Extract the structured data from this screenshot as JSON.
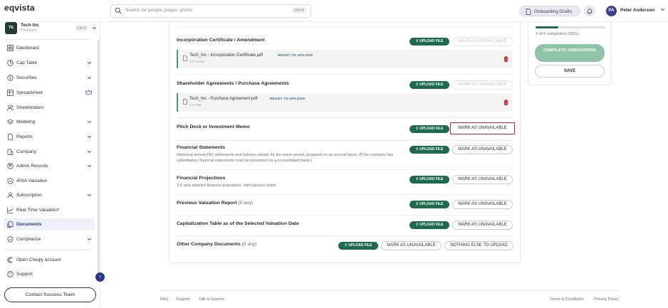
{
  "app": {
    "logo": "eqvista"
  },
  "search": {
    "placeholder": "Search for people, pages, grants",
    "shortcut": "Ctrl K"
  },
  "header": {
    "drafts_label": "Onboarding Drafts",
    "user_initials": "PA",
    "user_name": "Peter Anderson"
  },
  "company": {
    "initials": "TE",
    "name": "Tech Inc",
    "plan": "Premium",
    "shortcut": "Ctrl O"
  },
  "sidebar": {
    "items": [
      {
        "label": "Dashboard"
      },
      {
        "label": "Cap Table"
      },
      {
        "label": "Securities"
      },
      {
        "label": "Spreadsheet"
      },
      {
        "label": "Shareholders"
      },
      {
        "label": "Modeling"
      },
      {
        "label": "Reports"
      },
      {
        "label": "Company"
      },
      {
        "label": "Admin Records"
      },
      {
        "label": "409A Valuation"
      },
      {
        "label": "Subscription"
      },
      {
        "label": "Real-Time Valuation*"
      },
      {
        "label": "Documents"
      },
      {
        "label": "Compliance"
      }
    ],
    "bottom": [
      {
        "label": "Open Cheqly account"
      },
      {
        "label": "Support"
      }
    ],
    "cta": "Contact Success Team"
  },
  "documents": {
    "upload_label": "UPLOAD FILE",
    "mark_label": "MARK AS UNAVAILABLE",
    "nothing_label": "NOTHING ELSE TO UPLOAD",
    "rows": [
      {
        "title": "Incorporation Certificate / Amendment"
      },
      {
        "title": "Shareholder Agreements / Purchase Agreements"
      },
      {
        "title": "Pitch Deck or Investment Memo"
      },
      {
        "title": "Financial Statements",
        "desc": "Historical annual P&L statements and balance sheets for the same period, prepared on an accrual basis. (If the company has subsidiaries, financial statements must be presented on a consolidated basis.)"
      },
      {
        "title": "Financial Projections",
        "desc": "3-5 year detailed financial projections, with balance sheet"
      },
      {
        "title": "Previous Valuation Report",
        "optional": "(if any)"
      },
      {
        "title": "Capitalization Table as of the Selected Valuation Date"
      },
      {
        "title": "Other Company Documents",
        "optional": "(if any)"
      }
    ],
    "files": [
      {
        "name": "Tech_Inc - Incorporation Certificate.pdf",
        "size": "177.78 KB",
        "status": "READY TO UPLOAD"
      },
      {
        "name": "Tech_Inc - Purchase Agreement.pdf",
        "size": "3.17 MB",
        "status": "READY TO UPLOAD"
      }
    ]
  },
  "progress": {
    "text": "2 of 6 completed (33%)",
    "fraction": 0.33,
    "complete_label": "COMPLETE ONBOARDING",
    "save_label": "SAVE"
  },
  "footer": {
    "links": [
      "FAQ",
      "Support",
      "Talk to Experts"
    ],
    "right_links": [
      "Terms & Conditions",
      "Privacy Policy"
    ]
  }
}
